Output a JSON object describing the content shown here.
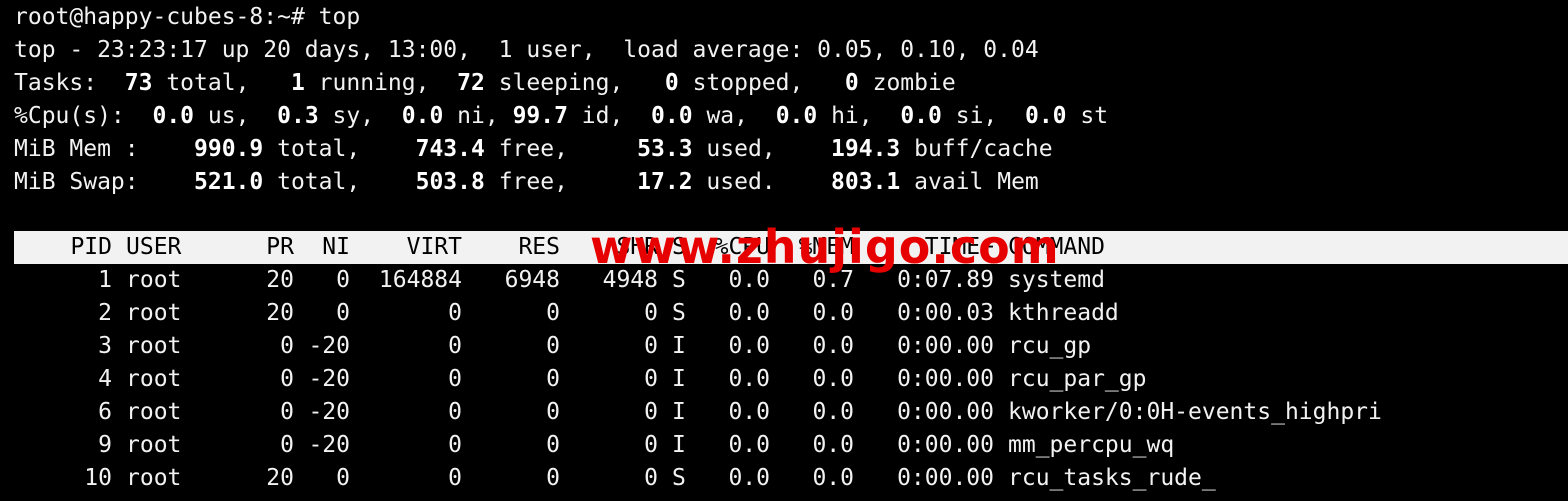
{
  "terminal": {
    "prompt": "root@happy-cubes-8:~# top",
    "summary": {
      "uptime_prefix": "top - 23:23:17 up 20 days, 13:00,  1 user,  load average: 0.05, 0.10, 0.04",
      "tasks_label": "Tasks: ",
      "tasks_total": " 73",
      "tasks_total_label": " total,   ",
      "tasks_running": "1",
      "tasks_running_label": " running,  ",
      "tasks_sleeping": "72",
      "tasks_sleeping_label": " sleeping,   ",
      "tasks_stopped": "0",
      "tasks_stopped_label": " stopped,   ",
      "tasks_zombie": "0",
      "tasks_zombie_label": " zombie",
      "cpu_label": "%Cpu(s):  ",
      "cpu_us": "0.0",
      "cpu_us_label": " us,  ",
      "cpu_sy": "0.3",
      "cpu_sy_label": " sy,  ",
      "cpu_ni": "0.0",
      "cpu_ni_label": " ni, ",
      "cpu_id": "99.7",
      "cpu_id_label": " id,  ",
      "cpu_wa": "0.0",
      "cpu_wa_label": " wa,  ",
      "cpu_hi": "0.0",
      "cpu_hi_label": " hi,  ",
      "cpu_si": "0.0",
      "cpu_si_label": " si,  ",
      "cpu_st": "0.0",
      "cpu_st_label": " st",
      "mem_label": "MiB Mem :    ",
      "mem_total": "990.9",
      "mem_total_label": " total,    ",
      "mem_free": "743.4",
      "mem_free_label": " free,     ",
      "mem_used": "53.3",
      "mem_used_label": " used,    ",
      "mem_buff": "194.3",
      "mem_buff_label": " buff/cache",
      "swap_label": "MiB Swap:    ",
      "swap_total": "521.0",
      "swap_total_label": " total,    ",
      "swap_free": "503.8",
      "swap_free_label": " free,     ",
      "swap_used": "17.2",
      "swap_used_label": " used.    ",
      "swap_avail": "803.1",
      "swap_avail_label": " avail Mem"
    },
    "columns": {
      "pid": "PID",
      "user": "USER",
      "pr": "PR",
      "ni": "NI",
      "virt": "VIRT",
      "res": "RES",
      "shr": "SHR",
      "s": "S",
      "cpu": "%CPU",
      "mem": "%MEM",
      "time": "TIME+",
      "command": "COMMAND"
    },
    "processes": [
      {
        "pid": "1",
        "user": "root",
        "pr": "20",
        "ni": "0",
        "virt": "164884",
        "res": "6948",
        "shr": "4948",
        "s": "S",
        "cpu": "0.0",
        "mem": "0.7",
        "time": "0:07.89",
        "command": "systemd"
      },
      {
        "pid": "2",
        "user": "root",
        "pr": "20",
        "ni": "0",
        "virt": "0",
        "res": "0",
        "shr": "0",
        "s": "S",
        "cpu": "0.0",
        "mem": "0.0",
        "time": "0:00.03",
        "command": "kthreadd"
      },
      {
        "pid": "3",
        "user": "root",
        "pr": "0",
        "ni": "-20",
        "virt": "0",
        "res": "0",
        "shr": "0",
        "s": "I",
        "cpu": "0.0",
        "mem": "0.0",
        "time": "0:00.00",
        "command": "rcu_gp"
      },
      {
        "pid": "4",
        "user": "root",
        "pr": "0",
        "ni": "-20",
        "virt": "0",
        "res": "0",
        "shr": "0",
        "s": "I",
        "cpu": "0.0",
        "mem": "0.0",
        "time": "0:00.00",
        "command": "rcu_par_gp"
      },
      {
        "pid": "6",
        "user": "root",
        "pr": "0",
        "ni": "-20",
        "virt": "0",
        "res": "0",
        "shr": "0",
        "s": "I",
        "cpu": "0.0",
        "mem": "0.0",
        "time": "0:00.00",
        "command": "kworker/0:0H-events_highpri"
      },
      {
        "pid": "9",
        "user": "root",
        "pr": "0",
        "ni": "-20",
        "virt": "0",
        "res": "0",
        "shr": "0",
        "s": "I",
        "cpu": "0.0",
        "mem": "0.0",
        "time": "0:00.00",
        "command": "mm_percpu_wq"
      },
      {
        "pid": "10",
        "user": "root",
        "pr": "20",
        "ni": "0",
        "virt": "0",
        "res": "0",
        "shr": "0",
        "s": "S",
        "cpu": "0.0",
        "mem": "0.0",
        "time": "0:00.00",
        "command": "rcu_tasks_rude_"
      }
    ]
  },
  "watermark": {
    "text": "www.zhujigo.com",
    "color": "#e60000"
  },
  "colors": {
    "background": "#000000",
    "foreground": "#f2f2f2",
    "header_bar": "#f2f2f2"
  }
}
